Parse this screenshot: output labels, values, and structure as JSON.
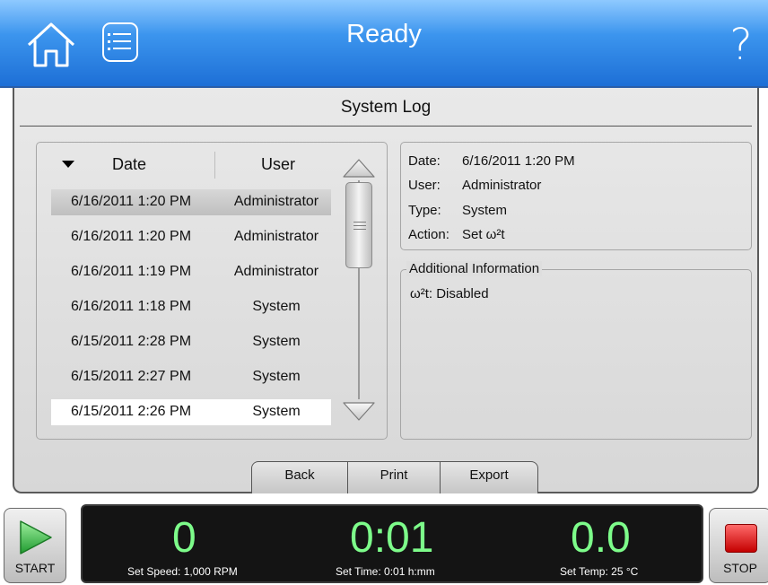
{
  "header": {
    "status": "Ready",
    "help_glyph": "?",
    "icons": [
      "home-icon",
      "menu-list-icon",
      "help-icon"
    ]
  },
  "panel": {
    "title": "System Log",
    "columns": {
      "date": "Date",
      "user": "User"
    },
    "rows": [
      {
        "date": "6/16/2011 1:20 PM",
        "user": "Administrator"
      },
      {
        "date": "6/16/2011 1:20 PM",
        "user": "Administrator"
      },
      {
        "date": "6/16/2011 1:19 PM",
        "user": "Administrator"
      },
      {
        "date": "6/16/2011 1:18 PM",
        "user": "System"
      },
      {
        "date": "6/15/2011 2:28 PM",
        "user": "System"
      },
      {
        "date": "6/15/2011 2:27 PM",
        "user": "System"
      },
      {
        "date": "6/15/2011 2:26 PM",
        "user": "System"
      }
    ],
    "detail": {
      "date_label": "Date:",
      "date_value": "6/16/2011 1:20 PM",
      "user_label": "User:",
      "user_value": "Administrator",
      "type_label": "Type:",
      "type_value": "System",
      "action_label": "Action:",
      "action_value": "Set ω²t"
    },
    "additional": {
      "legend": "Additional Information",
      "text": "ω²t:  Disabled"
    },
    "buttons": {
      "back": "Back",
      "print": "Print",
      "export": "Export"
    }
  },
  "footer": {
    "start_label": "START",
    "stop_label": "STOP",
    "speed_value": "0",
    "speed_set": "Set Speed: 1,000 RPM",
    "time_value": "0:01",
    "time_set": "Set Time: 0:01 h:mm",
    "temp_value": "0.0",
    "temp_set": "Set Temp: 25 °C"
  },
  "colors": {
    "header_blue": "#1d6fd6",
    "readout_green": "#7dfc8a",
    "start_green": "#37b84b",
    "stop_red": "#d60000"
  }
}
